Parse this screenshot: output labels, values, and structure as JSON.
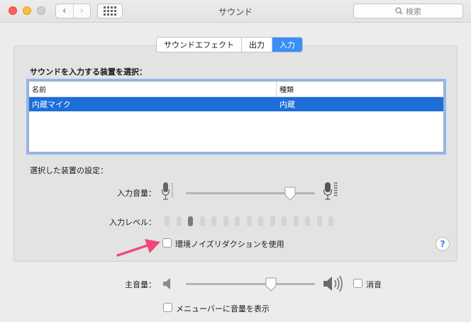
{
  "window": {
    "title": "サウンド"
  },
  "toolbar": {
    "search_placeholder": "検索",
    "back_glyph": "‹",
    "forward_glyph": "›"
  },
  "tabs": [
    {
      "label": "サウンドエフェクト",
      "active": false
    },
    {
      "label": "出力",
      "active": false
    },
    {
      "label": "入力",
      "active": true
    }
  ],
  "input_panel": {
    "section_title": "サウンドを入力する装置を選択：",
    "columns": [
      "名前",
      "種類"
    ],
    "devices": [
      {
        "name": "内蔵マイク",
        "type": "内蔵",
        "selected": true
      }
    ],
    "settings_label": "選択した装置の設定：",
    "input_volume_label": "入力音量：",
    "input_volume": 0.81,
    "input_level_label": "入力レベル：",
    "input_level_bars": 15,
    "input_level_active_bar": 3,
    "noise_reduction_label": "環境ノイズリダクションを使用",
    "noise_reduction_checked": false,
    "help_label": "?"
  },
  "output": {
    "main_volume_label": "主音量：",
    "main_volume": 0.66,
    "mute_label": "消音",
    "mute_checked": false,
    "show_in_menubar_label": "メニューバーに音量を表示",
    "show_in_menubar_checked": false
  },
  "colors": {
    "accent": "#3a8ef7",
    "selection": "#1d6ed8",
    "annotation_arrow": "#f0487a"
  }
}
